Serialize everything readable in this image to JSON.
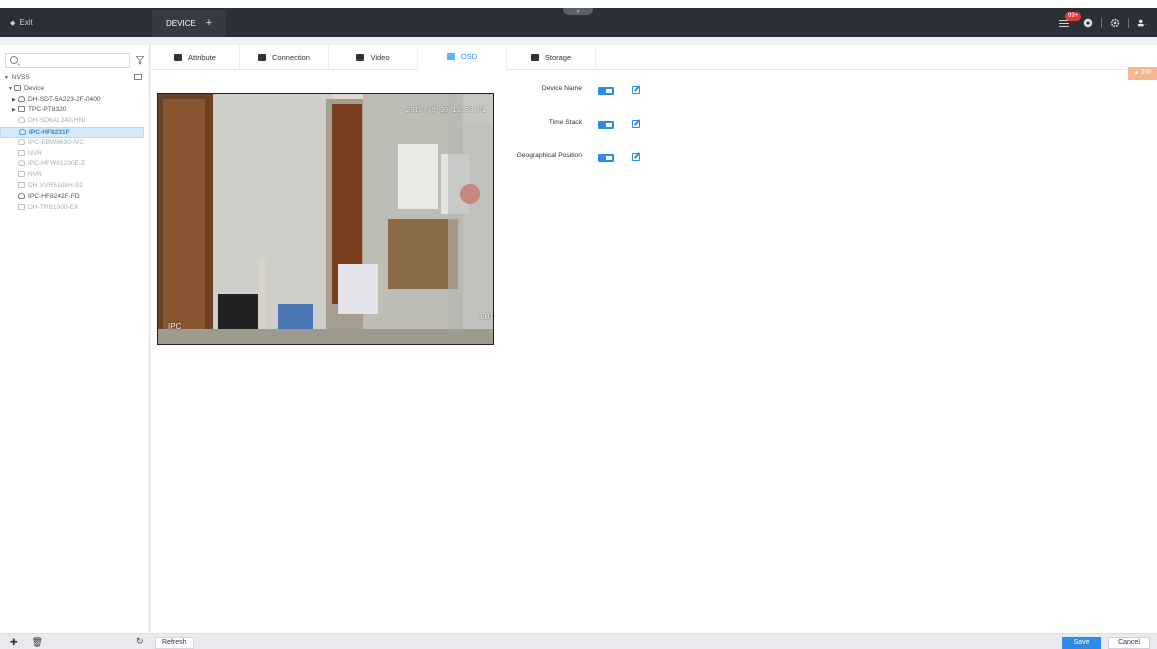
{
  "topbar": {
    "exit_label": "Exit",
    "tab_label": "DEVICE",
    "add_tab": "+",
    "alarm_badge": "99+"
  },
  "sidebar": {
    "search_placeholder": "",
    "root": "NVSS",
    "items": [
      {
        "label": "Device",
        "level": 1,
        "state": "normal",
        "icon": "folder-icon",
        "expand": "▼"
      },
      {
        "label": "DH-SDT-5A223-2F-0400",
        "level": 2,
        "state": "normal",
        "icon": "camera-icon",
        "expand": "▶"
      },
      {
        "label": "TPC-PT8320",
        "level": 2,
        "state": "normal",
        "icon": "thermal-icon",
        "expand": "▶"
      },
      {
        "label": "DH-SD6AL240-HNI",
        "level": 2,
        "state": "dim",
        "icon": "dome-icon",
        "expand": ""
      },
      {
        "label": "IPC-HF8231F",
        "level": 2,
        "state": "selected",
        "icon": "camera-icon",
        "expand": ""
      },
      {
        "label": "IPC-EBW8630-IVC",
        "level": 2,
        "state": "dim",
        "icon": "camera-icon",
        "expand": ""
      },
      {
        "label": "NVR",
        "level": 2,
        "state": "dim",
        "icon": "nvr-icon",
        "expand": ""
      },
      {
        "label": "IPC-HFW81230E-Z",
        "level": 2,
        "state": "dim",
        "icon": "camera-icon",
        "expand": ""
      },
      {
        "label": "NVR",
        "level": 2,
        "state": "dim",
        "icon": "nvr-icon",
        "expand": ""
      },
      {
        "label": "DH-XVR5108H-S2",
        "level": 2,
        "state": "dim",
        "icon": "nvr-icon",
        "expand": ""
      },
      {
        "label": "IPC-HF8242F-FD",
        "level": 2,
        "state": "normal",
        "icon": "camera-icon",
        "expand": ""
      },
      {
        "label": "DH-TRS1000-EX",
        "level": 2,
        "state": "dim",
        "icon": "nvr-icon",
        "expand": ""
      }
    ]
  },
  "tabs": [
    {
      "label": "Attribute",
      "active": false,
      "icon": "attribute-icon"
    },
    {
      "label": "Connection",
      "active": false,
      "icon": "connection-icon"
    },
    {
      "label": "Video",
      "active": false,
      "icon": "video-icon"
    },
    {
      "label": "OSD",
      "active": true,
      "icon": "osd-icon"
    },
    {
      "label": "Storage",
      "active": false,
      "icon": "storage-icon"
    }
  ],
  "alarm_tag": "200",
  "video": {
    "timestamp_overlay": "2018-09-19 11:33:01",
    "channel_overlay": "IPC",
    "corner_text": "ai0"
  },
  "osd": {
    "fields": [
      {
        "label": "Device Name",
        "enabled": true
      },
      {
        "label": "Time Stack",
        "enabled": true
      },
      {
        "label": "Geographical Position",
        "enabled": true
      }
    ]
  },
  "bottom": {
    "refresh_label": "Refresh",
    "save_label": "Save",
    "cancel_label": "Cancel"
  },
  "colors": {
    "accent": "#2d8ceb",
    "topbar_bg": "#2b2f38",
    "alarm_badge": "#e8383c"
  }
}
